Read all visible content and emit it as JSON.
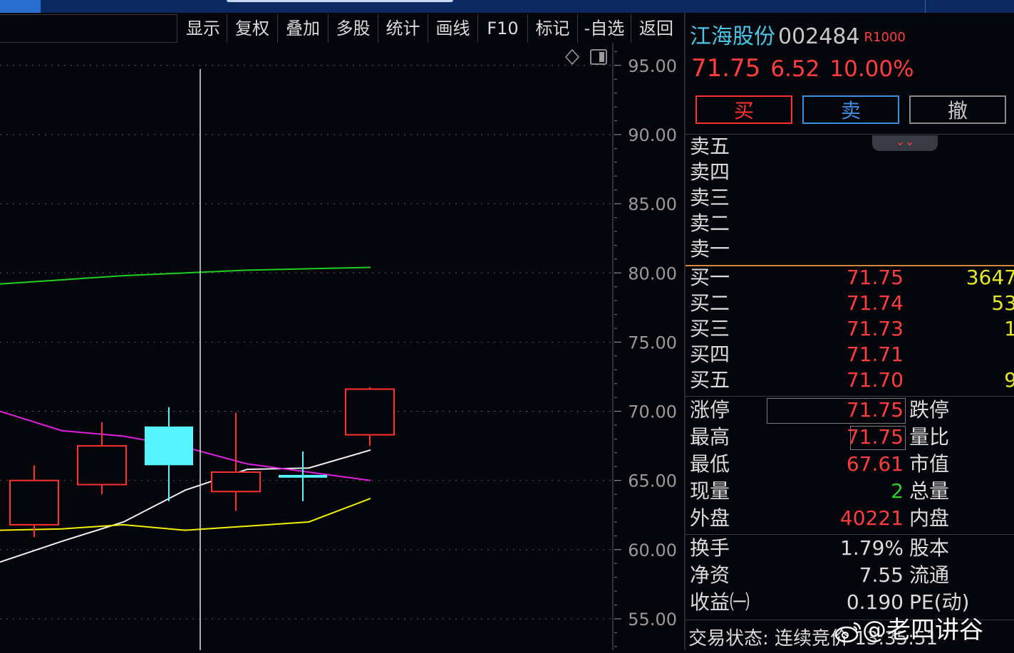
{
  "toolbar": {
    "items": [
      "显示",
      "复权",
      "叠加",
      "多股",
      "统计",
      "画线",
      "F10",
      "标记",
      "-自选",
      "返回"
    ]
  },
  "chart_data": {
    "type": "candlestick",
    "y_axis_labels": [
      "95.00",
      "90.00",
      "85.00",
      "80.00",
      "75.00",
      "70.00",
      "65.00",
      "60.00",
      "55.00"
    ],
    "ylim": [
      53.0,
      97.6
    ],
    "colors": {
      "up": "#ff3030",
      "down": "#55f5ff",
      "ma_white": "#f0f0f0",
      "ma_yellow": "#f0f000",
      "ma_magenta": "#e020e0",
      "ma_green": "#20d020",
      "grid": "#5a5a6a"
    },
    "candles": [
      {
        "open": 61.8,
        "close": 65.0,
        "high": 66.1,
        "low": 60.9,
        "color": "up"
      },
      {
        "open": 64.7,
        "close": 67.5,
        "high": 69.2,
        "low": 64.0,
        "color": "up"
      },
      {
        "open": 68.9,
        "close": 66.1,
        "high": 70.3,
        "low": 63.5,
        "color": "down"
      },
      {
        "open": 64.2,
        "close": 65.6,
        "high": 69.9,
        "low": 62.8,
        "color": "up"
      },
      {
        "open": 65.4,
        "close": 65.2,
        "high": 67.1,
        "low": 63.5,
        "color": "down"
      },
      {
        "open": 68.3,
        "close": 71.6,
        "high": 71.75,
        "low": 67.5,
        "color": "up"
      }
    ],
    "ma_lines": [
      {
        "color": "ma_white",
        "values": [
          59.1,
          60.6,
          62.0,
          64.3,
          65.8,
          65.9,
          67.2
        ]
      },
      {
        "color": "ma_yellow",
        "values": [
          61.4,
          61.5,
          61.8,
          61.4,
          61.7,
          62.0,
          63.7
        ]
      },
      {
        "color": "ma_magenta",
        "values": [
          70.0,
          68.6,
          68.2,
          67.4,
          66.2,
          65.6,
          65.0
        ]
      },
      {
        "color": "ma_green",
        "values": [
          79.2,
          79.5,
          79.8,
          80.0,
          80.2,
          80.3,
          80.4
        ]
      }
    ]
  },
  "quote": {
    "name": "江海股份",
    "code": "002484",
    "badge": "R1000",
    "price": "71.75",
    "change": "6.52",
    "change_pct": "10.00%"
  },
  "buttons": {
    "buy": "买",
    "sell": "卖",
    "cancel": "撤"
  },
  "asks": [
    {
      "label": "卖五",
      "price": "",
      "vol": ""
    },
    {
      "label": "卖四",
      "price": "",
      "vol": ""
    },
    {
      "label": "卖三",
      "price": "",
      "vol": ""
    },
    {
      "label": "卖二",
      "price": "",
      "vol": ""
    },
    {
      "label": "卖一",
      "price": "",
      "vol": ""
    }
  ],
  "bids": [
    {
      "label": "买一",
      "price": "71.75",
      "vol": "3647"
    },
    {
      "label": "买二",
      "price": "71.74",
      "vol": "53"
    },
    {
      "label": "买三",
      "price": "71.73",
      "vol": "1"
    },
    {
      "label": "买四",
      "price": "71.71",
      "vol": ""
    },
    {
      "label": "买五",
      "price": "71.70",
      "vol": "9"
    }
  ],
  "stats1": [
    {
      "label": "涨停",
      "value": "71.75",
      "right_label": "跌停"
    },
    {
      "label": "最高",
      "value": "71.75",
      "right_label": "量比"
    },
    {
      "label": "最低",
      "value": "67.61",
      "right_label": "市值"
    },
    {
      "label": "现量",
      "value": "2",
      "right_label": "总量"
    },
    {
      "label": "外盘",
      "value": "40221",
      "right_label": "内盘"
    }
  ],
  "stats2": [
    {
      "label": "换手",
      "value": "1.79%",
      "right_label": "股本"
    },
    {
      "label": "净资",
      "value": "7.55",
      "right_label": "流通"
    },
    {
      "label": "收益㈠",
      "value": "0.190",
      "right_label": "PE(动)"
    }
  ],
  "status": "交易状态: 连续竞价 13:35:51",
  "watermark": "@老四讲谷"
}
